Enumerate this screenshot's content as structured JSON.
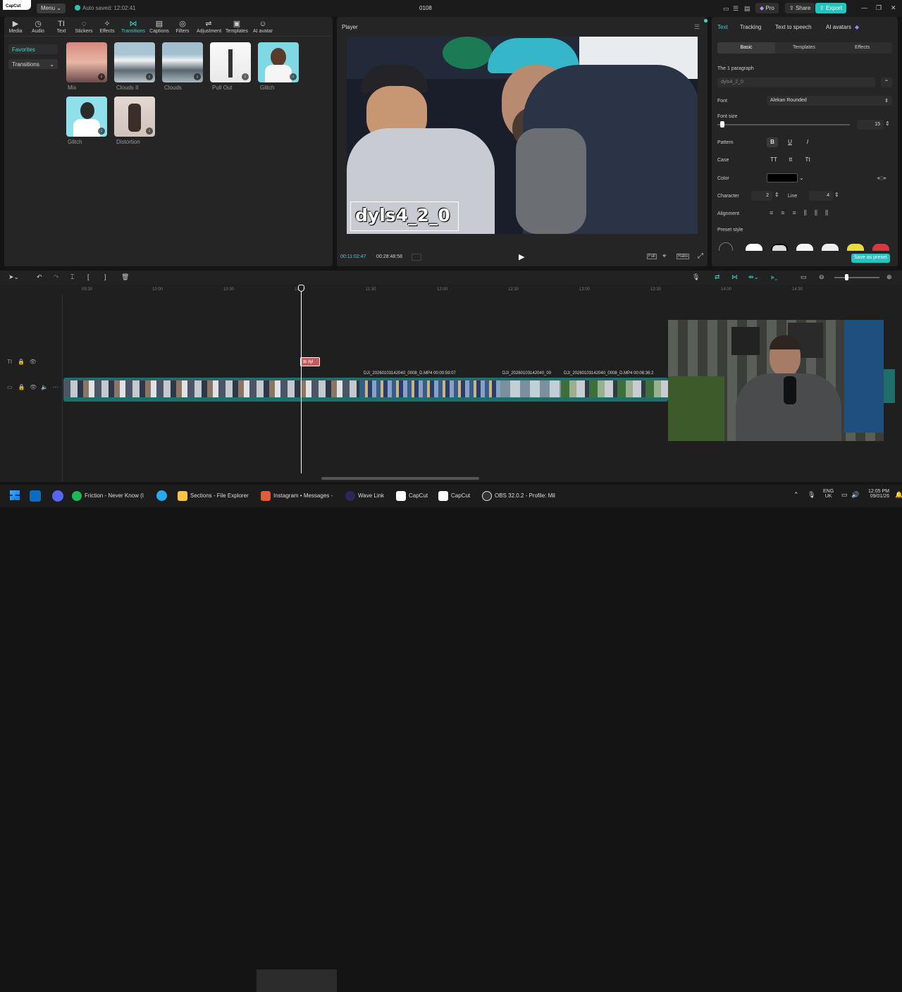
{
  "titlebar": {
    "app": "CapCut",
    "menu": "Menu",
    "autosave": "Auto saved: 12:02:41",
    "project": "0108",
    "pro": "Pro",
    "share": "Share",
    "export": "Export"
  },
  "toolbar": [
    {
      "label": "Media",
      "icon": "▶"
    },
    {
      "label": "Audio",
      "icon": "◷"
    },
    {
      "label": "Text",
      "icon": "TI"
    },
    {
      "label": "Stickers",
      "icon": "◌"
    },
    {
      "label": "Effects",
      "icon": "✧"
    },
    {
      "label": "Transitions",
      "icon": "⋈"
    },
    {
      "label": "Captions",
      "icon": "▤"
    },
    {
      "label": "Filters",
      "icon": "◎"
    },
    {
      "label": "Adjustment",
      "icon": "⇌"
    },
    {
      "label": "Templates",
      "icon": "▣"
    },
    {
      "label": "AI avatar",
      "icon": "☺"
    }
  ],
  "sidebar": {
    "favorites": "Favorites",
    "transitions": "Transitions"
  },
  "transitions": [
    "Mix",
    "Clouds II",
    "Clouds",
    "Pull Out",
    "Glitch",
    "Glitch",
    "Distortion"
  ],
  "player": {
    "label": "Player",
    "caption": "dyls4_2_0",
    "current_time": "00:11:02:47",
    "total_time": "00:28:48:58",
    "full": "Full",
    "ratio": "Ratio"
  },
  "right": {
    "tabs": [
      "Text",
      "Tracking",
      "Text to speech",
      "AI avatars"
    ],
    "subtabs": [
      "Basic",
      "Templates",
      "Effects"
    ],
    "paragraph": "The 1 paragraph",
    "text_value": "dyls4_2_0",
    "font_label": "Font",
    "font_value": "Alekan Rounded",
    "fontsize_label": "Font size",
    "fontsize_value": "15",
    "pattern_label": "Pattern",
    "case_label": "Case",
    "case_opts": [
      "TT",
      "tt",
      "Tt"
    ],
    "color_label": "Color",
    "character_label": "Character",
    "character_value": "2",
    "line_label": "Line",
    "line_value": "4",
    "alignment_label": "Alignment",
    "preset_label": "Preset style",
    "save_preset": "Save as preset"
  },
  "timeline": {
    "ticks": [
      "09:30",
      "10:00",
      "10:30",
      "11:00",
      "11:30",
      "12:00",
      "12:30",
      "13:00",
      "13:30",
      "14:00",
      "14:30"
    ],
    "text_clip": "dyl",
    "clip_labels": [
      "DJI_20260103142040_0008_D.MP4  00:00:59:07",
      "DJI_20260103142040_00",
      "DJI_20260103142040_0008_D.MP4  00:06:36:2"
    ]
  },
  "taskbar": {
    "items": [
      "Friction - Never Know (I",
      "Sections - File Explorer",
      "Instagram • Messages -",
      "Wave Link",
      "CapCut",
      "CapCut",
      "OBS 32.0.2 - Profile: Mil"
    ],
    "lang": "ENG",
    "region": "UK",
    "time": "12:05 PM",
    "date": "09/01/26"
  }
}
